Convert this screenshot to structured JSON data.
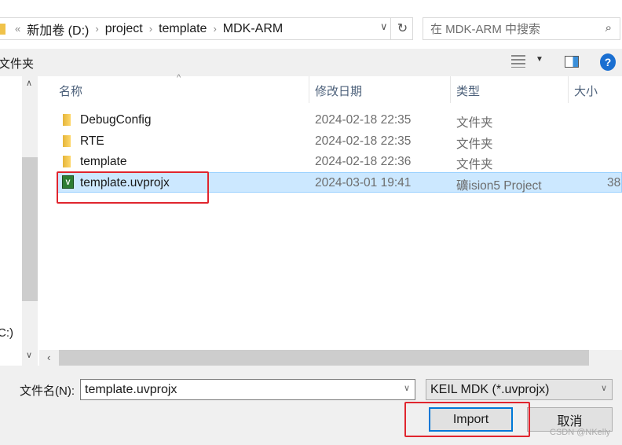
{
  "address": {
    "overflow": "«",
    "crumbs": [
      "新加卷 (D:)",
      "project",
      "template",
      "MDK-ARM"
    ]
  },
  "search": {
    "placeholder": "在 MDK-ARM 中搜索"
  },
  "toolbar": {
    "new_folder_label": "文件夹"
  },
  "nav": {
    "drive_label": "C:)"
  },
  "columns": {
    "name": "名称",
    "date": "修改日期",
    "type": "类型",
    "size": "大小"
  },
  "files": [
    {
      "name": "DebugConfig",
      "date": "2024-02-18 22:35",
      "type": "文件夹",
      "size": "",
      "icon": "folder-icon"
    },
    {
      "name": "RTE",
      "date": "2024-02-18 22:35",
      "type": "文件夹",
      "size": "",
      "icon": "folder-icon"
    },
    {
      "name": "template",
      "date": "2024-02-18 22:36",
      "type": "文件夹",
      "size": "",
      "icon": "folder-icon"
    },
    {
      "name": "template.uvprojx",
      "date": "2024-03-01 19:41",
      "type": "礦ision5 Project",
      "size": "38",
      "icon": "uvision-project-icon",
      "selected": true
    }
  ],
  "footer": {
    "filename_label": "文件名(N):",
    "filename_value": "template.uvprojx",
    "filter_value": "KEIL MDK (*.uvprojx)",
    "import_label": "Import",
    "cancel_label": "取消"
  },
  "watermark": "CSDN @NKelly",
  "colors": {
    "selection": "#cce8ff",
    "highlight_box": "#e0252e",
    "help": "#1a6fd1"
  }
}
